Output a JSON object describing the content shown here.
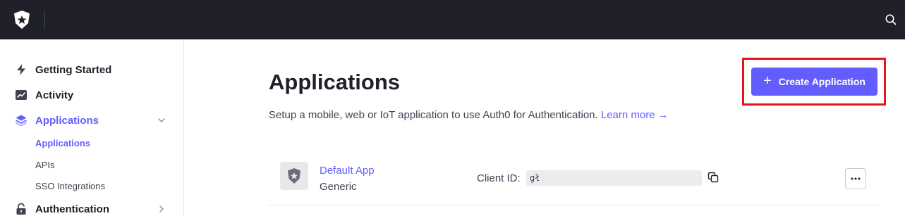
{
  "topbar": {
    "logo_icon": "auth0-star-shield-icon",
    "search_icon": "search-icon"
  },
  "sidebar": {
    "items": [
      {
        "label": "Getting Started",
        "icon": "lightning-icon",
        "active": false
      },
      {
        "label": "Activity",
        "icon": "trending-chart-icon",
        "active": false
      },
      {
        "label": "Applications",
        "icon": "layers-icon",
        "active": true,
        "expanded": true,
        "children": [
          {
            "label": "Applications",
            "active": true
          },
          {
            "label": "APIs",
            "active": false
          },
          {
            "label": "SSO Integrations",
            "active": false
          }
        ]
      },
      {
        "label": "Authentication",
        "icon": "lock-icon",
        "active": false
      }
    ]
  },
  "main": {
    "title": "Applications",
    "subtitle": "Setup a mobile, web or IoT application to use Auth0 for Authentication.",
    "learn_more": "Learn more",
    "learn_more_arrow": "→",
    "create_button": {
      "plus": "+",
      "label": "Create Application"
    },
    "apps": [
      {
        "name": "Default App",
        "type": "Generic",
        "client_id_label": "Client ID:",
        "client_id_value": "gł"
      }
    ]
  },
  "colors": {
    "topbar": "#1f2029",
    "accent": "#635dff",
    "highlight": "#e3141e"
  }
}
